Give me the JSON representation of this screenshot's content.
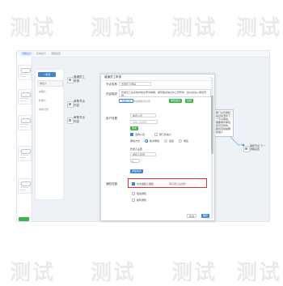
{
  "watermark": "测试",
  "app_bar": {
    "tabs": [
      "流程设计",
      "表单设计",
      "流程设置"
    ]
  },
  "list_panel": {
    "add_button": "+ 新增",
    "items": [
      "审批人",
      "办理人",
      "抄送人",
      "条件分支"
    ],
    "selected_index": 0
  },
  "flow": {
    "node_1": "普通员工\n申请",
    "node_2": "审核节点\n内容",
    "node_3": "审核节点\n内容",
    "right_box": "部门主管审核后自动流转下一节点审批，需要填写审批意见及附件，超时自动提醒处理人",
    "right_node": "审核节点 下一\n流程设置"
  },
  "dialog": {
    "title": "普通员工申请",
    "close_icon": "×",
    "fields": {
      "name_label": "节点名称",
      "name_value": "普通员工申请",
      "desc_label": "内容描述",
      "desc_value": "普通员工在系统中提交申请单据，填写相关信息并上传附件，提交后进入审批流程…",
      "upload_button": "选择文件",
      "upload_hint": "未选择任何文件",
      "approve_button": "审批通过",
      "reject_button": "驳回"
    },
    "user_section": {
      "label": "用户设置",
      "dropdown_value": "指定人员",
      "search_placeholder": "请输入关键字",
      "add_button": "添加",
      "check_labels": [
        "选择人员",
        "部门负责人"
      ],
      "radio_label": "审批方式",
      "radio_options": [
        "依次审批",
        "会签",
        "或签"
      ],
      "sub_label": "抄送人设置",
      "sub_value": "发起人自选"
    },
    "add_condition_button": "添加条件",
    "notify": {
      "label": "通知设置",
      "checkbox_label": "允许发起人撤回",
      "hint": "审批通过后通知"
    },
    "other": {
      "options": [
        "短信通知",
        "邮件通知"
      ]
    },
    "footer": {
      "cancel": "取消",
      "confirm": "确定"
    }
  },
  "colors": {
    "primary": "#3b86d6",
    "success": "#3ab54a",
    "highlight": "#d9382e"
  }
}
